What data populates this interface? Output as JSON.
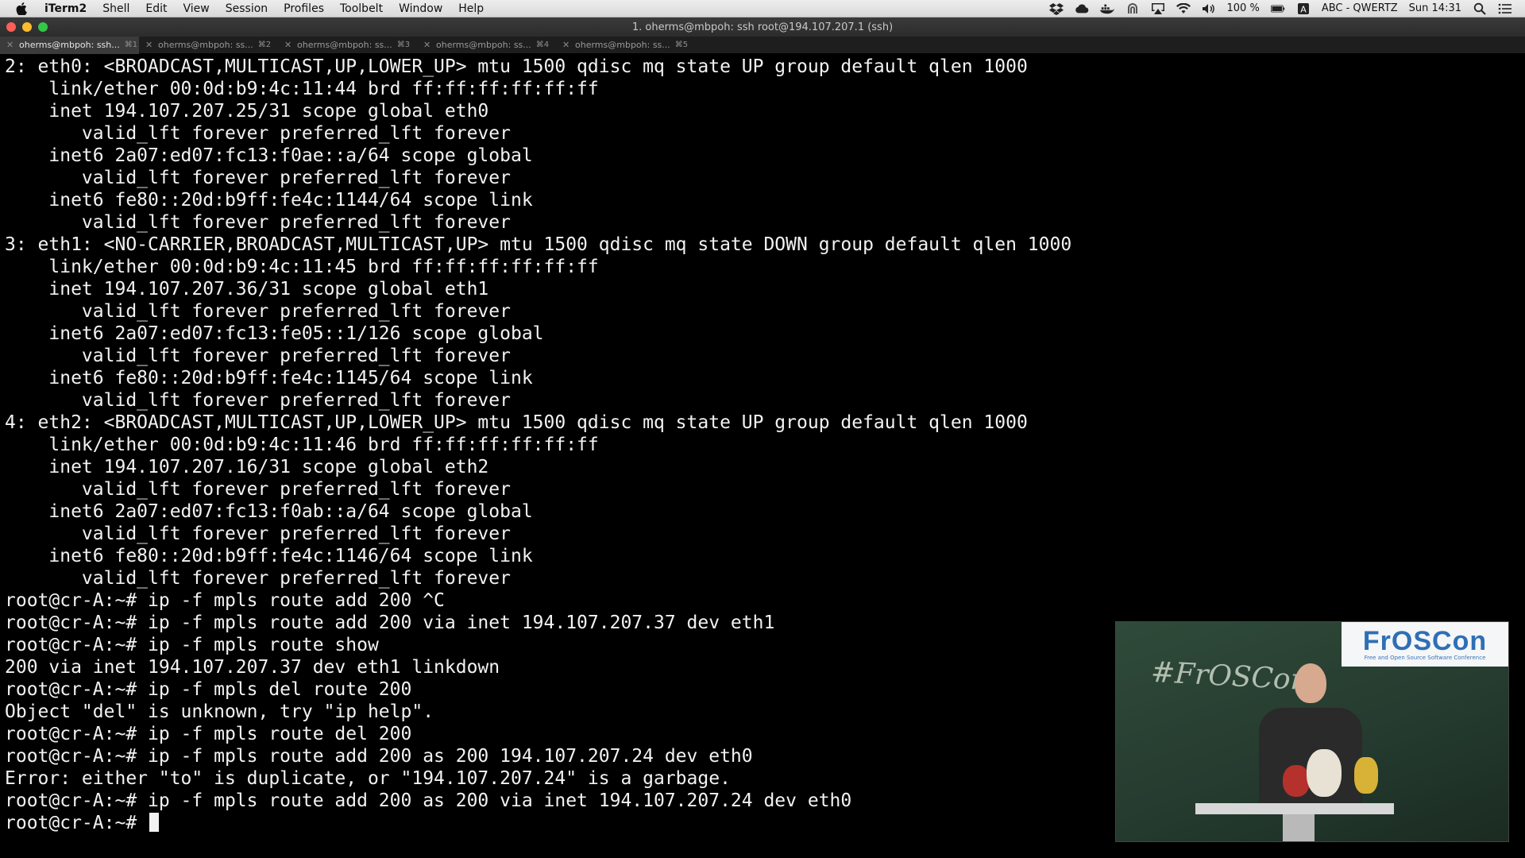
{
  "menubar": {
    "app_name": "iTerm2",
    "menus": [
      "Shell",
      "Edit",
      "View",
      "Session",
      "Profiles",
      "Toolbelt",
      "Window",
      "Help"
    ],
    "status": {
      "battery": "100 %",
      "input_source": "ABC - QWERTZ",
      "clock": "Sun 14:31"
    }
  },
  "window": {
    "title": "1. oherms@mbpoh: ssh root@194.107.207.1 (ssh)"
  },
  "tabs": [
    {
      "label": "oherms@mbpoh: ssh...",
      "shortcut": "⌘1",
      "active": true
    },
    {
      "label": "oherms@mbpoh: ss...",
      "shortcut": "⌘2",
      "active": false
    },
    {
      "label": "oherms@mbpoh: ss...",
      "shortcut": "⌘3",
      "active": false
    },
    {
      "label": "oherms@mbpoh: ss...",
      "shortcut": "⌘4",
      "active": false
    },
    {
      "label": "oherms@mbpoh: ss...",
      "shortcut": "⌘5",
      "active": false
    }
  ],
  "terminal": {
    "lines": [
      "2: eth0: <BROADCAST,MULTICAST,UP,LOWER_UP> mtu 1500 qdisc mq state UP group default qlen 1000",
      "    link/ether 00:0d:b9:4c:11:44 brd ff:ff:ff:ff:ff:ff",
      "    inet 194.107.207.25/31 scope global eth0",
      "       valid_lft forever preferred_lft forever",
      "    inet6 2a07:ed07:fc13:f0ae::a/64 scope global",
      "       valid_lft forever preferred_lft forever",
      "    inet6 fe80::20d:b9ff:fe4c:1144/64 scope link",
      "       valid_lft forever preferred_lft forever",
      "3: eth1: <NO-CARRIER,BROADCAST,MULTICAST,UP> mtu 1500 qdisc mq state DOWN group default qlen 1000",
      "    link/ether 00:0d:b9:4c:11:45 brd ff:ff:ff:ff:ff:ff",
      "    inet 194.107.207.36/31 scope global eth1",
      "       valid_lft forever preferred_lft forever",
      "    inet6 2a07:ed07:fc13:fe05::1/126 scope global",
      "       valid_lft forever preferred_lft forever",
      "    inet6 fe80::20d:b9ff:fe4c:1145/64 scope link",
      "       valid_lft forever preferred_lft forever",
      "4: eth2: <BROADCAST,MULTICAST,UP,LOWER_UP> mtu 1500 qdisc mq state UP group default qlen 1000",
      "    link/ether 00:0d:b9:4c:11:46 brd ff:ff:ff:ff:ff:ff",
      "    inet 194.107.207.16/31 scope global eth2",
      "       valid_lft forever preferred_lft forever",
      "    inet6 2a07:ed07:fc13:f0ab::a/64 scope global",
      "       valid_lft forever preferred_lft forever",
      "    inet6 fe80::20d:b9ff:fe4c:1146/64 scope link",
      "       valid_lft forever preferred_lft forever",
      "root@cr-A:~# ip -f mpls route add 200 ^C",
      "root@cr-A:~# ip -f mpls route add 200 via inet 194.107.207.37 dev eth1",
      "root@cr-A:~# ip -f mpls route show",
      "200 via inet 194.107.207.37 dev eth1 linkdown",
      "root@cr-A:~# ip -f mpls del route 200",
      "Object \"del\" is unknown, try \"ip help\".",
      "root@cr-A:~# ip -f mpls route del 200",
      "root@cr-A:~# ip -f mpls route add 200 as 200 194.107.207.24 dev eth0",
      "Error: either \"to\" is duplicate, or \"194.107.207.24\" is a garbage.",
      "root@cr-A:~# ip -f mpls route add 200 as 200 via inet 194.107.207.24 dev eth0"
    ],
    "prompt": "root@cr-A:~# "
  },
  "video_overlay": {
    "logo_text": "FrOSCon",
    "logo_tagline": "Free and Open Source Software Conference",
    "chalk_text": "#FrOSCon"
  },
  "colors": {
    "terminal_bg": "#000000",
    "terminal_fg": "#f2f2f2",
    "active_tab": "#3b3b3b"
  }
}
